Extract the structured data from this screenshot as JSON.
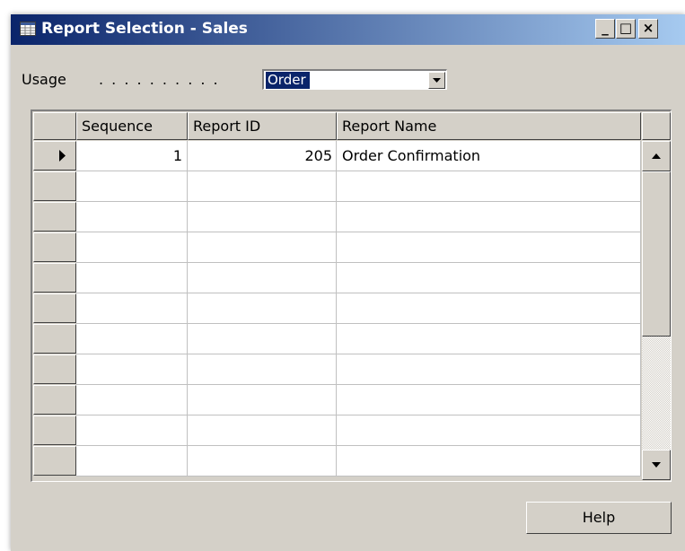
{
  "window": {
    "title": "Report Selection - Sales",
    "icon": "table-icon",
    "controls": {
      "minimize": "_",
      "maximize": "□",
      "close": "×"
    }
  },
  "usage": {
    "label": "Usage",
    "dots": ". . . . . . . . . .",
    "value": "Order"
  },
  "grid": {
    "columns": [
      "Sequence",
      "Report ID",
      "Report Name"
    ],
    "rows": [
      {
        "sequence": "1",
        "report_id": "205",
        "report_name": "Order Confirmation"
      },
      {
        "sequence": "",
        "report_id": "",
        "report_name": ""
      },
      {
        "sequence": "",
        "report_id": "",
        "report_name": ""
      },
      {
        "sequence": "",
        "report_id": "",
        "report_name": ""
      },
      {
        "sequence": "",
        "report_id": "",
        "report_name": ""
      },
      {
        "sequence": "",
        "report_id": "",
        "report_name": ""
      },
      {
        "sequence": "",
        "report_id": "",
        "report_name": ""
      },
      {
        "sequence": "",
        "report_id": "",
        "report_name": ""
      },
      {
        "sequence": "",
        "report_id": "",
        "report_name": ""
      },
      {
        "sequence": "",
        "report_id": "",
        "report_name": ""
      },
      {
        "sequence": "",
        "report_id": "",
        "report_name": ""
      }
    ]
  },
  "buttons": {
    "help": "Help"
  },
  "colors": {
    "titlebar_start": "#0a246a",
    "titlebar_end": "#a6caf0",
    "dialog_face": "#d4d0c8",
    "selection": "#0a246a"
  }
}
